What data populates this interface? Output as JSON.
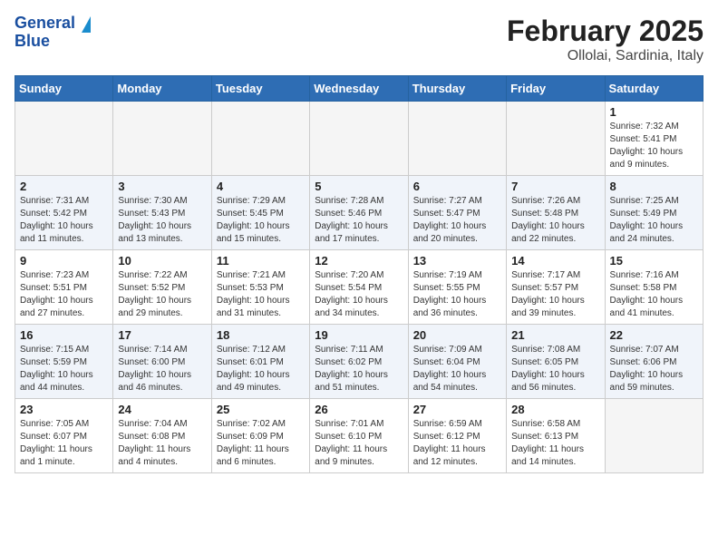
{
  "header": {
    "logo_line1": "General",
    "logo_line2": "Blue",
    "title": "February 2025",
    "subtitle": "Ollolai, Sardinia, Italy"
  },
  "days_of_week": [
    "Sunday",
    "Monday",
    "Tuesday",
    "Wednesday",
    "Thursday",
    "Friday",
    "Saturday"
  ],
  "weeks": [
    [
      {
        "day": "",
        "info": ""
      },
      {
        "day": "",
        "info": ""
      },
      {
        "day": "",
        "info": ""
      },
      {
        "day": "",
        "info": ""
      },
      {
        "day": "",
        "info": ""
      },
      {
        "day": "",
        "info": ""
      },
      {
        "day": "1",
        "info": "Sunrise: 7:32 AM\nSunset: 5:41 PM\nDaylight: 10 hours\nand 9 minutes."
      }
    ],
    [
      {
        "day": "2",
        "info": "Sunrise: 7:31 AM\nSunset: 5:42 PM\nDaylight: 10 hours\nand 11 minutes."
      },
      {
        "day": "3",
        "info": "Sunrise: 7:30 AM\nSunset: 5:43 PM\nDaylight: 10 hours\nand 13 minutes."
      },
      {
        "day": "4",
        "info": "Sunrise: 7:29 AM\nSunset: 5:45 PM\nDaylight: 10 hours\nand 15 minutes."
      },
      {
        "day": "5",
        "info": "Sunrise: 7:28 AM\nSunset: 5:46 PM\nDaylight: 10 hours\nand 17 minutes."
      },
      {
        "day": "6",
        "info": "Sunrise: 7:27 AM\nSunset: 5:47 PM\nDaylight: 10 hours\nand 20 minutes."
      },
      {
        "day": "7",
        "info": "Sunrise: 7:26 AM\nSunset: 5:48 PM\nDaylight: 10 hours\nand 22 minutes."
      },
      {
        "day": "8",
        "info": "Sunrise: 7:25 AM\nSunset: 5:49 PM\nDaylight: 10 hours\nand 24 minutes."
      }
    ],
    [
      {
        "day": "9",
        "info": "Sunrise: 7:23 AM\nSunset: 5:51 PM\nDaylight: 10 hours\nand 27 minutes."
      },
      {
        "day": "10",
        "info": "Sunrise: 7:22 AM\nSunset: 5:52 PM\nDaylight: 10 hours\nand 29 minutes."
      },
      {
        "day": "11",
        "info": "Sunrise: 7:21 AM\nSunset: 5:53 PM\nDaylight: 10 hours\nand 31 minutes."
      },
      {
        "day": "12",
        "info": "Sunrise: 7:20 AM\nSunset: 5:54 PM\nDaylight: 10 hours\nand 34 minutes."
      },
      {
        "day": "13",
        "info": "Sunrise: 7:19 AM\nSunset: 5:55 PM\nDaylight: 10 hours\nand 36 minutes."
      },
      {
        "day": "14",
        "info": "Sunrise: 7:17 AM\nSunset: 5:57 PM\nDaylight: 10 hours\nand 39 minutes."
      },
      {
        "day": "15",
        "info": "Sunrise: 7:16 AM\nSunset: 5:58 PM\nDaylight: 10 hours\nand 41 minutes."
      }
    ],
    [
      {
        "day": "16",
        "info": "Sunrise: 7:15 AM\nSunset: 5:59 PM\nDaylight: 10 hours\nand 44 minutes."
      },
      {
        "day": "17",
        "info": "Sunrise: 7:14 AM\nSunset: 6:00 PM\nDaylight: 10 hours\nand 46 minutes."
      },
      {
        "day": "18",
        "info": "Sunrise: 7:12 AM\nSunset: 6:01 PM\nDaylight: 10 hours\nand 49 minutes."
      },
      {
        "day": "19",
        "info": "Sunrise: 7:11 AM\nSunset: 6:02 PM\nDaylight: 10 hours\nand 51 minutes."
      },
      {
        "day": "20",
        "info": "Sunrise: 7:09 AM\nSunset: 6:04 PM\nDaylight: 10 hours\nand 54 minutes."
      },
      {
        "day": "21",
        "info": "Sunrise: 7:08 AM\nSunset: 6:05 PM\nDaylight: 10 hours\nand 56 minutes."
      },
      {
        "day": "22",
        "info": "Sunrise: 7:07 AM\nSunset: 6:06 PM\nDaylight: 10 hours\nand 59 minutes."
      }
    ],
    [
      {
        "day": "23",
        "info": "Sunrise: 7:05 AM\nSunset: 6:07 PM\nDaylight: 11 hours\nand 1 minute."
      },
      {
        "day": "24",
        "info": "Sunrise: 7:04 AM\nSunset: 6:08 PM\nDaylight: 11 hours\nand 4 minutes."
      },
      {
        "day": "25",
        "info": "Sunrise: 7:02 AM\nSunset: 6:09 PM\nDaylight: 11 hours\nand 6 minutes."
      },
      {
        "day": "26",
        "info": "Sunrise: 7:01 AM\nSunset: 6:10 PM\nDaylight: 11 hours\nand 9 minutes."
      },
      {
        "day": "27",
        "info": "Sunrise: 6:59 AM\nSunset: 6:12 PM\nDaylight: 11 hours\nand 12 minutes."
      },
      {
        "day": "28",
        "info": "Sunrise: 6:58 AM\nSunset: 6:13 PM\nDaylight: 11 hours\nand 14 minutes."
      },
      {
        "day": "",
        "info": ""
      }
    ]
  ]
}
